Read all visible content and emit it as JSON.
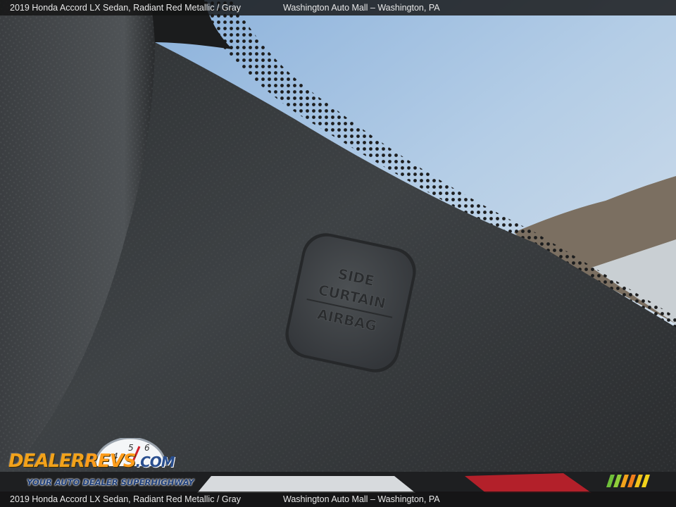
{
  "caption": {
    "vehicle": "2019 Honda Accord LX Sedan,  Radiant Red Metallic / Gray",
    "dealer": "Washington Auto Mall – Washington, PA"
  },
  "airbag_label": [
    "SIDE",
    "CURTAIN",
    "AIRBAG"
  ],
  "watermark": {
    "brand_part1": "DEALER",
    "brand_part2": "REVS",
    "brand_part3": ".COM",
    "tagline": "YOUR AUTO DEALER SUPERHIGHWAY"
  },
  "colors": {
    "panel": "#3a3d40",
    "headliner": "#4a4d50",
    "sky": "#a9c7e6",
    "accent_orange": "#f2a21b",
    "accent_blue": "#2a4f8f"
  }
}
